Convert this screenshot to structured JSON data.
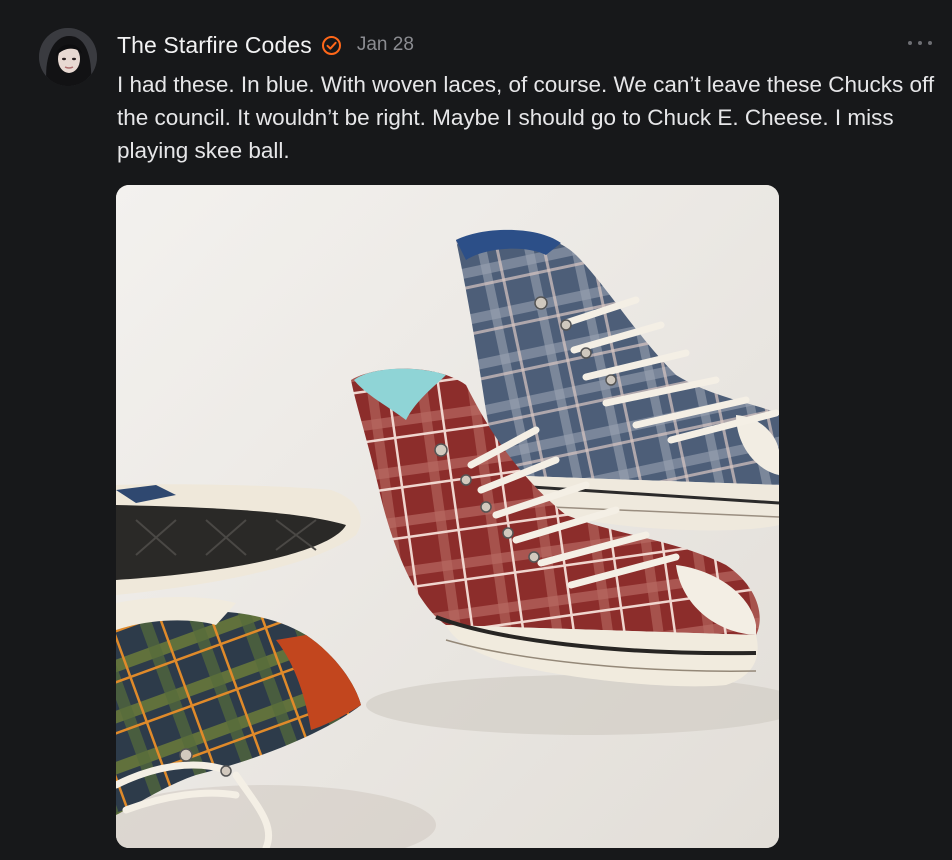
{
  "post": {
    "author": "The Starfire Codes",
    "date": "Jan 28",
    "body": "I had these. In blue. With woven laces, of course. We can’t leave these Chucks off the council. It wouldn’t be right. Maybe I should go to Chuck E. Cheese. I miss playing skee ball.",
    "icons": {
      "verified": "verified-badge-icon",
      "more": "more-options-icon"
    },
    "image": "plaid-high-top-sneakers-photo"
  },
  "colors": {
    "background": "#17181a",
    "accent": "#ff6719",
    "muted": "#8b8c91"
  }
}
